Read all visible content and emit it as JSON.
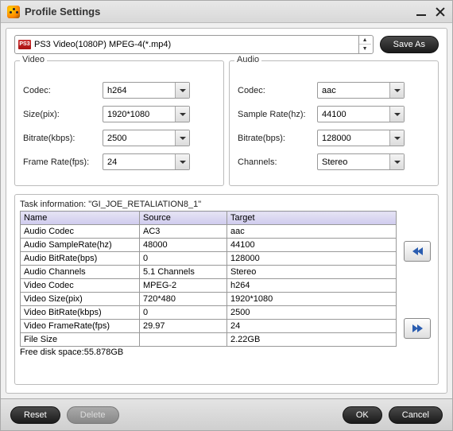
{
  "window": {
    "title": "Profile Settings"
  },
  "profile": {
    "icon_label": "PS3",
    "selected": "PS3 Video(1080P) MPEG-4(*.mp4)",
    "save_as": "Save As"
  },
  "video": {
    "heading": "Video",
    "codec_label": "Codec:",
    "codec": "h264",
    "size_label": "Size(pix):",
    "size": "1920*1080",
    "bitrate_label": "Bitrate(kbps):",
    "bitrate": "2500",
    "framerate_label": "Frame Rate(fps):",
    "framerate": "24"
  },
  "audio": {
    "heading": "Audio",
    "codec_label": "Codec:",
    "codec": "aac",
    "samplerate_label": "Sample Rate(hz):",
    "samplerate": "44100",
    "bitrate_label": "Bitrate(bps):",
    "bitrate": "128000",
    "channels_label": "Channels:",
    "channels": "Stereo"
  },
  "task": {
    "title": "Task information: \"GI_JOE_RETALIATION8_1\"",
    "headers": {
      "name": "Name",
      "source": "Source",
      "target": "Target"
    },
    "rows": [
      {
        "name": "Audio Codec",
        "source": "AC3",
        "target": "aac"
      },
      {
        "name": "Audio SampleRate(hz)",
        "source": "48000",
        "target": "44100"
      },
      {
        "name": "Audio BitRate(bps)",
        "source": "0",
        "target": "128000"
      },
      {
        "name": "Audio Channels",
        "source": "5.1 Channels",
        "target": "Stereo"
      },
      {
        "name": "Video Codec",
        "source": "MPEG-2",
        "target": "h264"
      },
      {
        "name": "Video Size(pix)",
        "source": "720*480",
        "target": "1920*1080"
      },
      {
        "name": "Video BitRate(kbps)",
        "source": "0",
        "target": "2500"
      },
      {
        "name": "Video FrameRate(fps)",
        "source": "29.97",
        "target": "24"
      },
      {
        "name": "File Size",
        "source": "",
        "target": "2.22GB"
      }
    ],
    "free_space": "Free disk space:55.878GB"
  },
  "buttons": {
    "reset": "Reset",
    "delete": "Delete",
    "ok": "OK",
    "cancel": "Cancel"
  }
}
